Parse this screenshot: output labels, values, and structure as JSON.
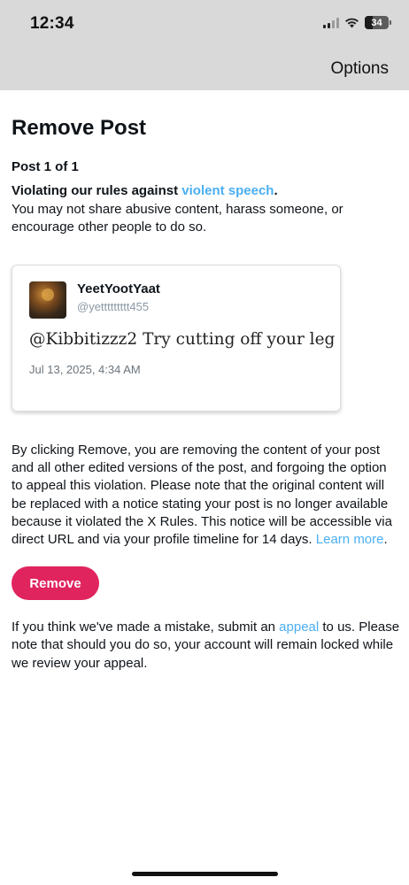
{
  "status_bar": {
    "time": "12:34",
    "battery_level": "34",
    "battery_fraction": 0.34,
    "signal_bars_active": 2,
    "signal_bars_total": 4
  },
  "header": {
    "options_label": "Options"
  },
  "page": {
    "title": "Remove Post",
    "post_counter": "Post 1 of 1",
    "violation_prefix": "Violating our rules against ",
    "violation_link": "violent speech",
    "violation_suffix": ".",
    "rule_description": "You may not share abusive content, harass someone, or encourage other people to do so."
  },
  "post": {
    "display_name": "YeetYootYaat",
    "handle": "@yettttttttt455",
    "text": "@Kibbitizzz2 Try cutting off your leg",
    "date": "Jul 13, 2025, 4:34 AM"
  },
  "consequence": {
    "text": "By clicking Remove, you are removing the content of your post and all other edited versions of the post, and forgoing the option to appeal this violation. Please note that the original content will be replaced with a notice stating your post is no longer available because it violated the X Rules. This notice will be accessible via direct URL and via your profile timeline for 14 days. ",
    "learn_more": "Learn more",
    "suffix": "."
  },
  "actions": {
    "remove_label": "Remove"
  },
  "appeal": {
    "prefix": "If you think we've made a mistake, submit an ",
    "link": "appeal",
    "suffix": " to us. Please note that should you do so, your account will remain locked while we review your appeal."
  },
  "colors": {
    "accent_link": "#1d9bf0",
    "remove_button": "#e0245e",
    "top_bar": "#d9d9d9"
  },
  "icons": [
    "signal-icon",
    "wifi-icon",
    "battery-icon"
  ]
}
